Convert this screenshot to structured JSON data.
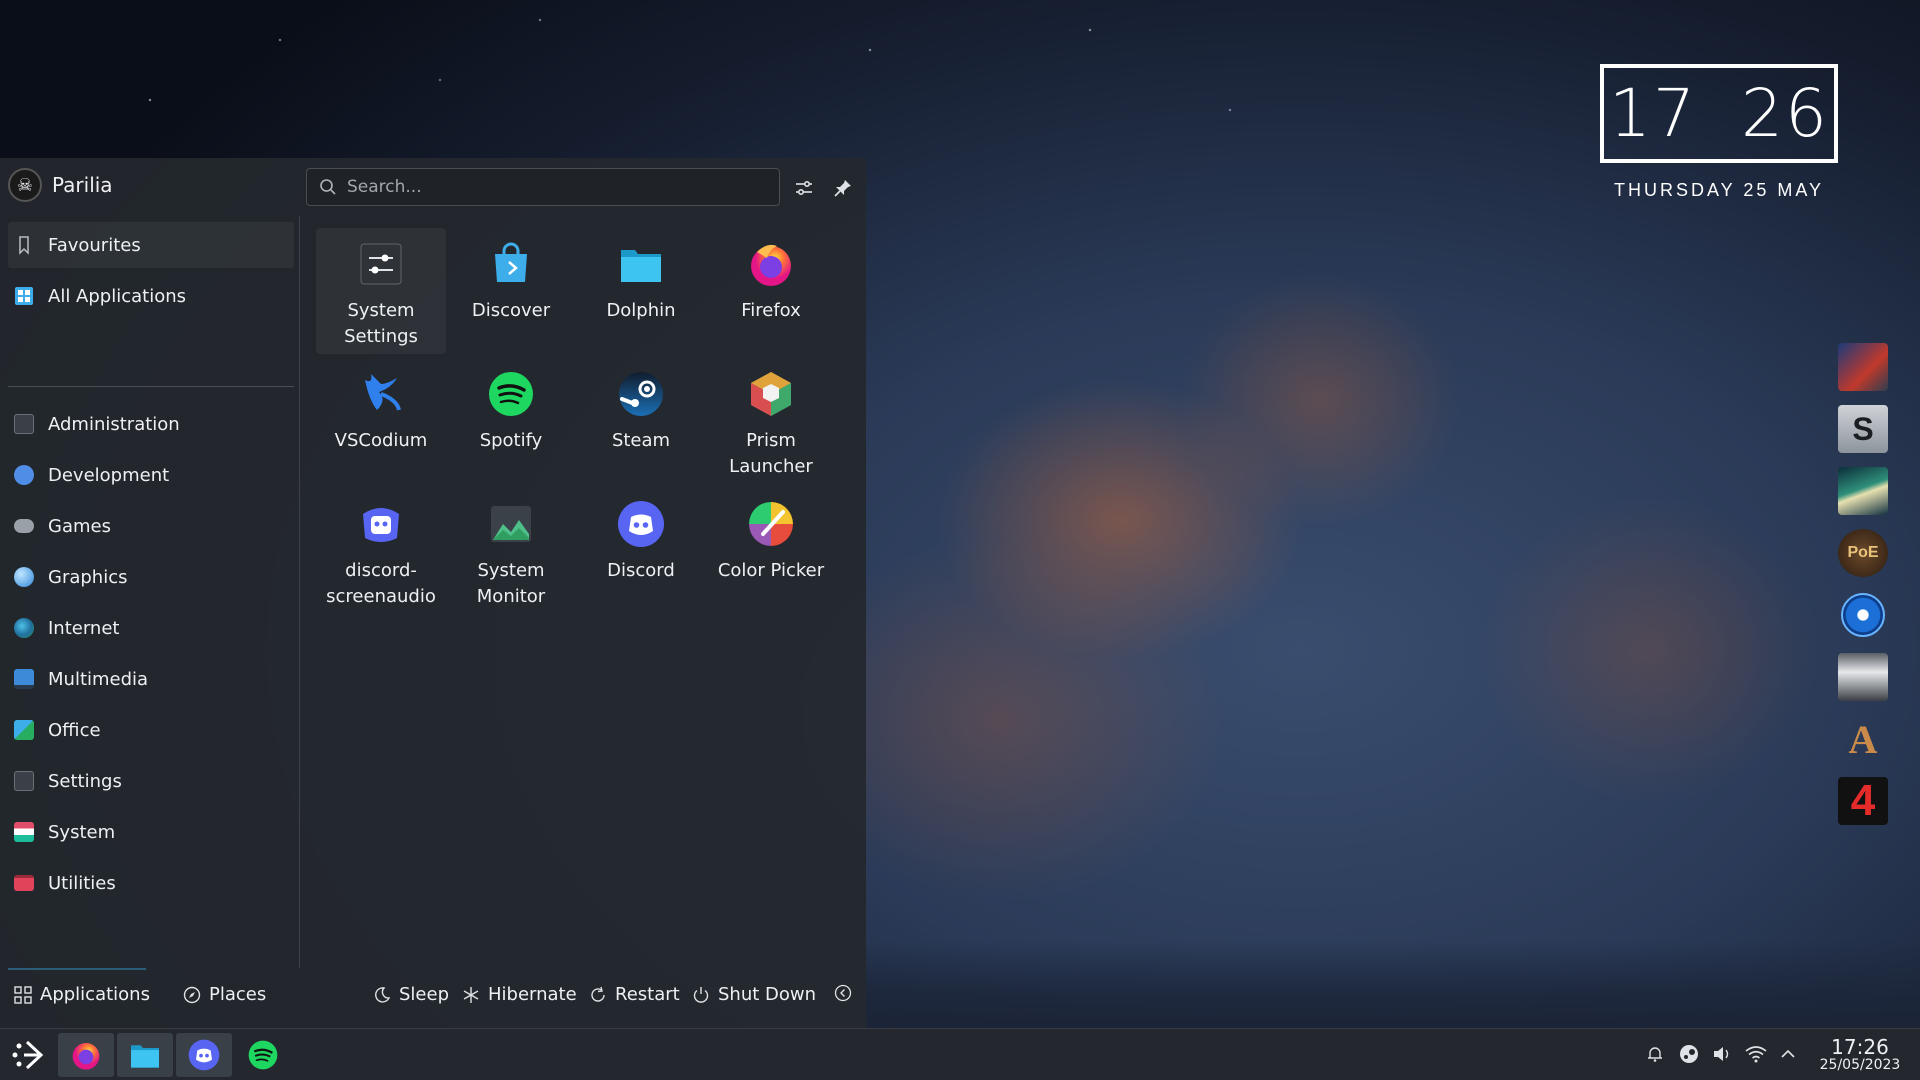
{
  "clock_widget": {
    "hours": "17",
    "minutes": "26",
    "date": "THURSDAY  25 MAY"
  },
  "launcher": {
    "username": "Parilia",
    "search": {
      "placeholder": "Search..."
    },
    "sidebar": {
      "items": [
        {
          "label": "Favourites",
          "icon": "bookmark-icon",
          "color": "#b9bec6"
        },
        {
          "label": "All Applications",
          "icon": "grid-icon",
          "color": "#3daee9"
        },
        {
          "label": "Administration",
          "icon": "settings-icon",
          "color": "#8a9099"
        },
        {
          "label": "Development",
          "icon": "development-icon",
          "color": "#4f8de6"
        },
        {
          "label": "Games",
          "icon": "gamepad-icon",
          "color": "#9aa0a8"
        },
        {
          "label": "Graphics",
          "icon": "graphics-icon",
          "color": "#4aa3df"
        },
        {
          "label": "Internet",
          "icon": "globe-icon",
          "color": "#2f9e60"
        },
        {
          "label": "Multimedia",
          "icon": "monitor-icon",
          "color": "#3d8ad9"
        },
        {
          "label": "Office",
          "icon": "office-icon",
          "color": "#3daee9"
        },
        {
          "label": "Settings",
          "icon": "settings-icon",
          "color": "#8a9099"
        },
        {
          "label": "System",
          "icon": "system-icon",
          "color": "#e04e6a"
        },
        {
          "label": "Utilities",
          "icon": "toolbox-icon",
          "color": "#e0445a"
        }
      ]
    },
    "apps": [
      {
        "label": "System Settings",
        "icon": "system-settings-icon"
      },
      {
        "label": "Discover",
        "icon": "discover-icon"
      },
      {
        "label": "Dolphin",
        "icon": "dolphin-folder-icon"
      },
      {
        "label": "Firefox",
        "icon": "firefox-icon"
      },
      {
        "label": "VSCodium",
        "icon": "vscodium-icon"
      },
      {
        "label": "Spotify",
        "icon": "spotify-icon"
      },
      {
        "label": "Steam",
        "icon": "steam-icon"
      },
      {
        "label": "Prism Launcher",
        "icon": "prism-launcher-icon"
      },
      {
        "label": "discord-screenaudio",
        "icon": "discord-screenaudio-icon"
      },
      {
        "label": "System Monitor",
        "icon": "system-monitor-icon"
      },
      {
        "label": "Discord",
        "icon": "discord-icon"
      },
      {
        "label": "Color Picker",
        "icon": "color-picker-icon"
      }
    ],
    "footer": {
      "applications": "Applications",
      "places": "Places",
      "sleep": "Sleep",
      "hibernate": "Hibernate",
      "restart": "Restart",
      "shutdown": "Shut Down"
    }
  },
  "taskbar": {
    "apps": [
      "kde-menu-icon",
      "firefox-icon",
      "dolphin-icon",
      "discord-icon",
      "spotify-icon"
    ],
    "tray": [
      "notifications-icon",
      "steam-icon",
      "volume-icon",
      "wifi-icon",
      "chevron-up-icon"
    ],
    "time": "17:26",
    "date": "25/05/2023"
  },
  "game_dock": {
    "items": [
      "game-tile-1",
      "game-tile-s",
      "game-tile-space",
      "game-tile-poe",
      "game-tile-orb",
      "game-tile-skull",
      "game-tile-a",
      "game-tile-4"
    ],
    "labels": {
      "s": "S",
      "poe": "PoE",
      "a": "A",
      "four": "4"
    }
  }
}
